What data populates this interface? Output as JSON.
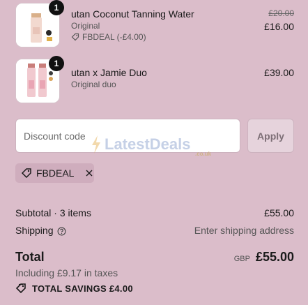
{
  "items": [
    {
      "name": "utan Coconut Tanning Water",
      "variant": "Original",
      "quantity": "1",
      "discount": "FBDEAL (-£4.00)",
      "original_price": "£20.00",
      "price": "£16.00"
    },
    {
      "name": "utan x Jamie Duo",
      "variant": "Original duo",
      "quantity": "1",
      "price": "£39.00"
    }
  ],
  "discount": {
    "placeholder": "Discount code",
    "apply_label": "Apply",
    "applied_code": "FBDEAL"
  },
  "watermark": {
    "text": "LatestDeals",
    "sub": ".co.uk"
  },
  "summary": {
    "subtotal_label": "Subtotal · 3 items",
    "subtotal_value": "£55.00",
    "shipping_label": "Shipping",
    "shipping_value": "Enter shipping address",
    "total_label": "Total",
    "currency": "GBP",
    "total_value": "£55.00",
    "taxes": "Including £9.17 in taxes",
    "savings": "TOTAL SAVINGS £4.00"
  },
  "colors": {
    "background": "#dbbdca",
    "tag_background": "#cfadbd",
    "badge": "#111111"
  }
}
